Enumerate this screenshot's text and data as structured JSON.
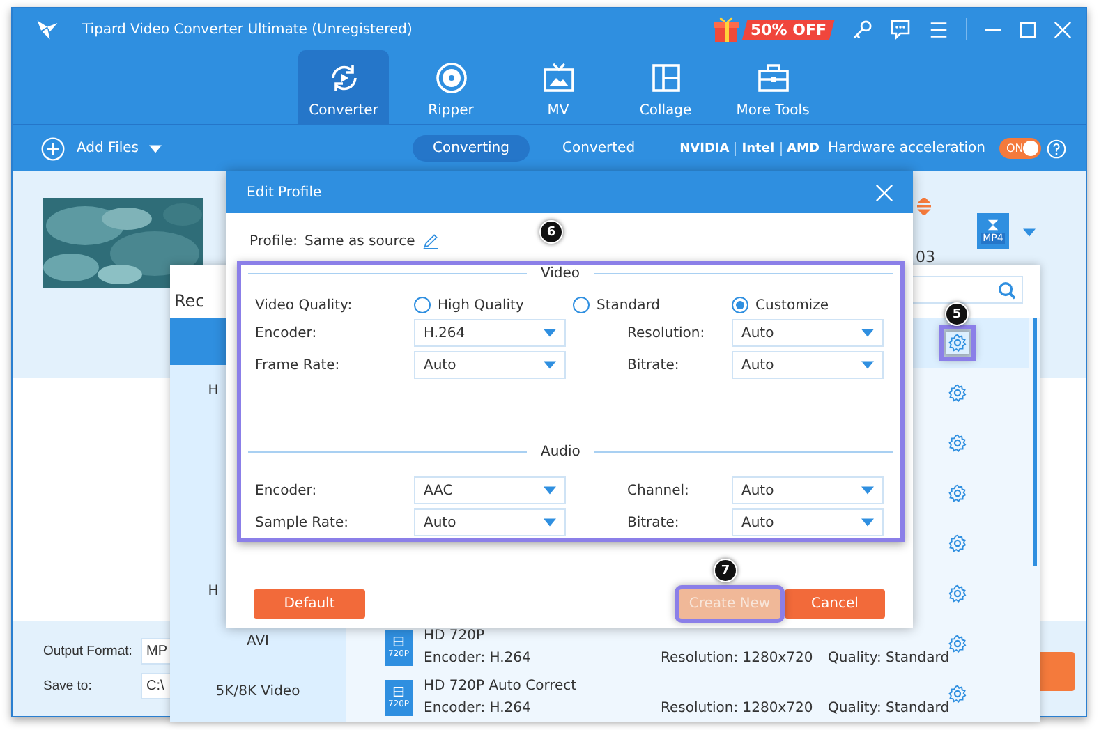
{
  "window": {
    "title": "Tipard Video Converter Ultimate (Unregistered)",
    "promo": "50% OFF"
  },
  "nav_tabs": [
    {
      "label": "Converter",
      "kind": "converter",
      "selected": true
    },
    {
      "label": "Ripper",
      "kind": "disc",
      "selected": false
    },
    {
      "label": "MV",
      "kind": "tv",
      "selected": false
    },
    {
      "label": "Collage",
      "kind": "collage",
      "selected": false
    },
    {
      "label": "More Tools",
      "kind": "toolbox",
      "selected": false
    }
  ],
  "toolbar": {
    "add_files": "Add Files",
    "sub_tabs": [
      {
        "label": "Converting",
        "selected": true
      },
      {
        "label": "Converted",
        "selected": false
      }
    ],
    "gpu_labels": [
      "NVIDIA",
      "Intel",
      "AMD"
    ],
    "hardware_acceleration": {
      "label": "Hardware acceleration",
      "toggle_text": "ON",
      "on": true
    }
  },
  "file_item": {
    "duration_fragment": "03",
    "format_badge": "MP4"
  },
  "bottom_bar": {
    "output_format_label": "Output Format:",
    "output_format_value": "MP",
    "save_to_label": "Save to:",
    "save_to_value": "C:\\"
  },
  "format_popup": {
    "tab_fragment": "Rec",
    "categories": [
      {
        "selected": true
      },
      {
        "label": "H",
        "selected": false
      },
      {
        "label": "H",
        "selected": false
      },
      {
        "label": "AVI",
        "selected": false
      },
      {
        "label": "5K/8K Video",
        "selected": false
      }
    ],
    "profiles": [
      {
        "selected": true,
        "step": "5"
      },
      {
        "selected": false
      },
      {
        "selected": false
      },
      {
        "selected": false
      },
      {
        "selected": false
      },
      {
        "selected": false
      },
      {
        "selected": false,
        "icon_label": "720P",
        "name": "HD 720P",
        "encoder": "Encoder: H.264",
        "resolution": "Resolution: 1280x720",
        "quality": "Quality: Standard"
      },
      {
        "selected": false,
        "icon_label": "720P",
        "name": "HD 720P Auto Correct",
        "encoder": "Encoder: H.264",
        "resolution": "Resolution: 1280x720",
        "quality": "Quality: Standard"
      }
    ]
  },
  "dialog": {
    "title": "Edit Profile",
    "profile_label": "Profile:",
    "profile_value": "Same as source",
    "step": "6",
    "video": {
      "heading": "Video",
      "quality_label": "Video Quality:",
      "quality_options": [
        {
          "label": "High Quality",
          "selected": false
        },
        {
          "label": "Standard",
          "selected": false
        },
        {
          "label": "Customize",
          "selected": true
        }
      ],
      "fields": [
        {
          "label": "Encoder:",
          "value": "H.264"
        },
        {
          "label": "Resolution:",
          "value": "Auto"
        },
        {
          "label": "Frame Rate:",
          "value": "Auto"
        },
        {
          "label": "Bitrate:",
          "value": "Auto"
        }
      ]
    },
    "audio": {
      "heading": "Audio",
      "fields": [
        {
          "label": "Encoder:",
          "value": "AAC"
        },
        {
          "label": "Channel:",
          "value": "Auto"
        },
        {
          "label": "Sample Rate:",
          "value": "Auto"
        },
        {
          "label": "Bitrate:",
          "value": "Auto"
        }
      ]
    },
    "buttons": [
      {
        "label": "Default",
        "kind": "default",
        "disabled": false
      },
      {
        "label": "Create New",
        "kind": "primary",
        "disabled": true,
        "step": "7"
      },
      {
        "label": "Cancel",
        "kind": "cancel",
        "disabled": false
      }
    ]
  }
}
